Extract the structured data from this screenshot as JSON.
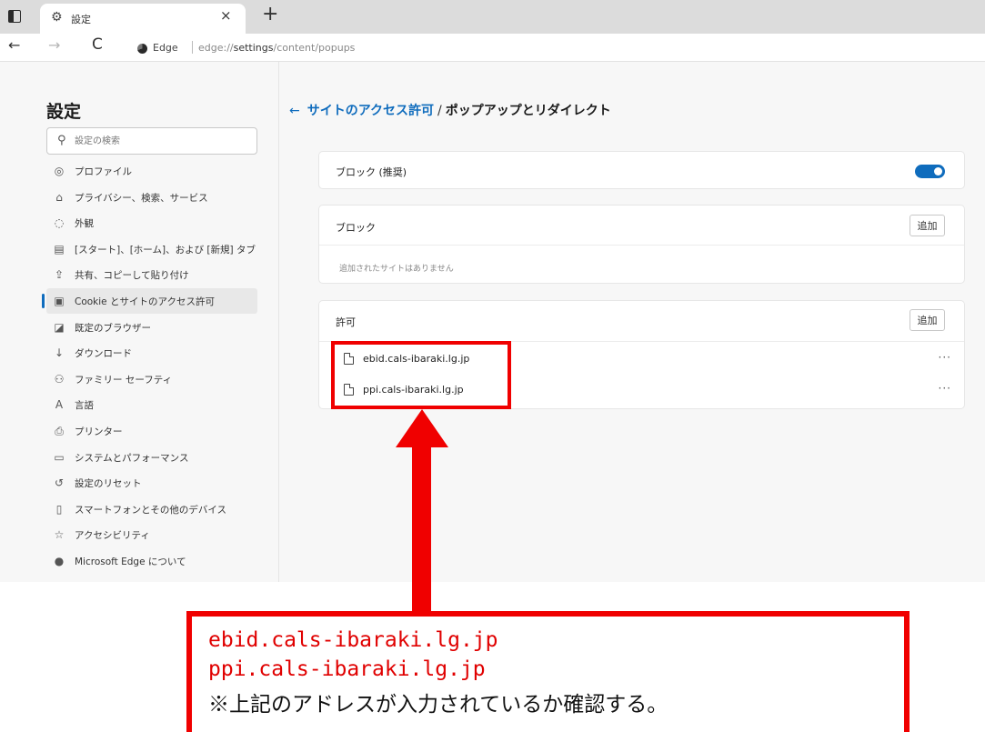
{
  "browser": {
    "tab": {
      "title": "設定",
      "icon": "gear-icon"
    },
    "nav": {
      "back": "←",
      "forward": "→",
      "reload": "C"
    },
    "address": {
      "site_label": "Edge",
      "url_host": "edge://",
      "url_path": "settings",
      "url_rest": "/content/popups"
    }
  },
  "sidebar": {
    "title": "設定",
    "search_placeholder": "設定の検索",
    "items": [
      {
        "icon": "profile-icon",
        "glyph": "◎",
        "label": "プロファイル",
        "active": false
      },
      {
        "icon": "lock-icon",
        "glyph": "⌂",
        "label": "プライバシー、検索、サービス",
        "active": false
      },
      {
        "icon": "appearance-icon",
        "glyph": "◌",
        "label": "外観",
        "active": false
      },
      {
        "icon": "start-home-icon",
        "glyph": "▤",
        "label": "[スタート]、[ホーム]、および [新規] タブ",
        "active": false
      },
      {
        "icon": "share-icon",
        "glyph": "⇪",
        "label": "共有、コピーして貼り付け",
        "active": false
      },
      {
        "icon": "cookie-icon",
        "glyph": "▣",
        "label": "Cookie とサイトのアクセス許可",
        "active": true
      },
      {
        "icon": "default-browser-icon",
        "glyph": "◪",
        "label": "既定のブラウザー",
        "active": false
      },
      {
        "icon": "download-icon",
        "glyph": "↓",
        "label": "ダウンロード",
        "active": false
      },
      {
        "icon": "family-icon",
        "glyph": "⚇",
        "label": "ファミリー セーフティ",
        "active": false
      },
      {
        "icon": "language-icon",
        "glyph": "A",
        "label": "言語",
        "active": false
      },
      {
        "icon": "printer-icon",
        "glyph": "⎙",
        "label": "プリンター",
        "active": false
      },
      {
        "icon": "system-icon",
        "glyph": "▭",
        "label": "システムとパフォーマンス",
        "active": false
      },
      {
        "icon": "reset-icon",
        "glyph": "↺",
        "label": "設定のリセット",
        "active": false
      },
      {
        "icon": "phone-icon",
        "glyph": "▯",
        "label": "スマートフォンとその他のデバイス",
        "active": false
      },
      {
        "icon": "accessibility-icon",
        "glyph": "☆",
        "label": "アクセシビリティ",
        "active": false
      },
      {
        "icon": "edge-logo-icon",
        "glyph": "●",
        "label": "Microsoft Edge について",
        "active": false
      }
    ]
  },
  "main": {
    "breadcrumb": {
      "back": "←",
      "parent": "サイトのアクセス許可",
      "separator": "/",
      "current": "ポップアップとリダイレクト"
    },
    "block_recommended": {
      "label": "ブロック (推奨)",
      "enabled": true
    },
    "block_section": {
      "title": "ブロック",
      "add_label": "追加",
      "empty_text": "追加されたサイトはありません"
    },
    "allow_section": {
      "title": "許可",
      "add_label": "追加",
      "sites": [
        {
          "name": "ebid.cals-ibaraki.lg.jp",
          "more": "···"
        },
        {
          "name": "ppi.cals-ibaraki.lg.jp",
          "more": "···"
        }
      ]
    }
  },
  "annotation": {
    "line1": "ebid.cals-ibaraki.lg.jp",
    "line2": "ppi.cals-ibaraki.lg.jp",
    "note": "※上記のアドレスが入力されているか確認する。",
    "color": "#f00000"
  }
}
